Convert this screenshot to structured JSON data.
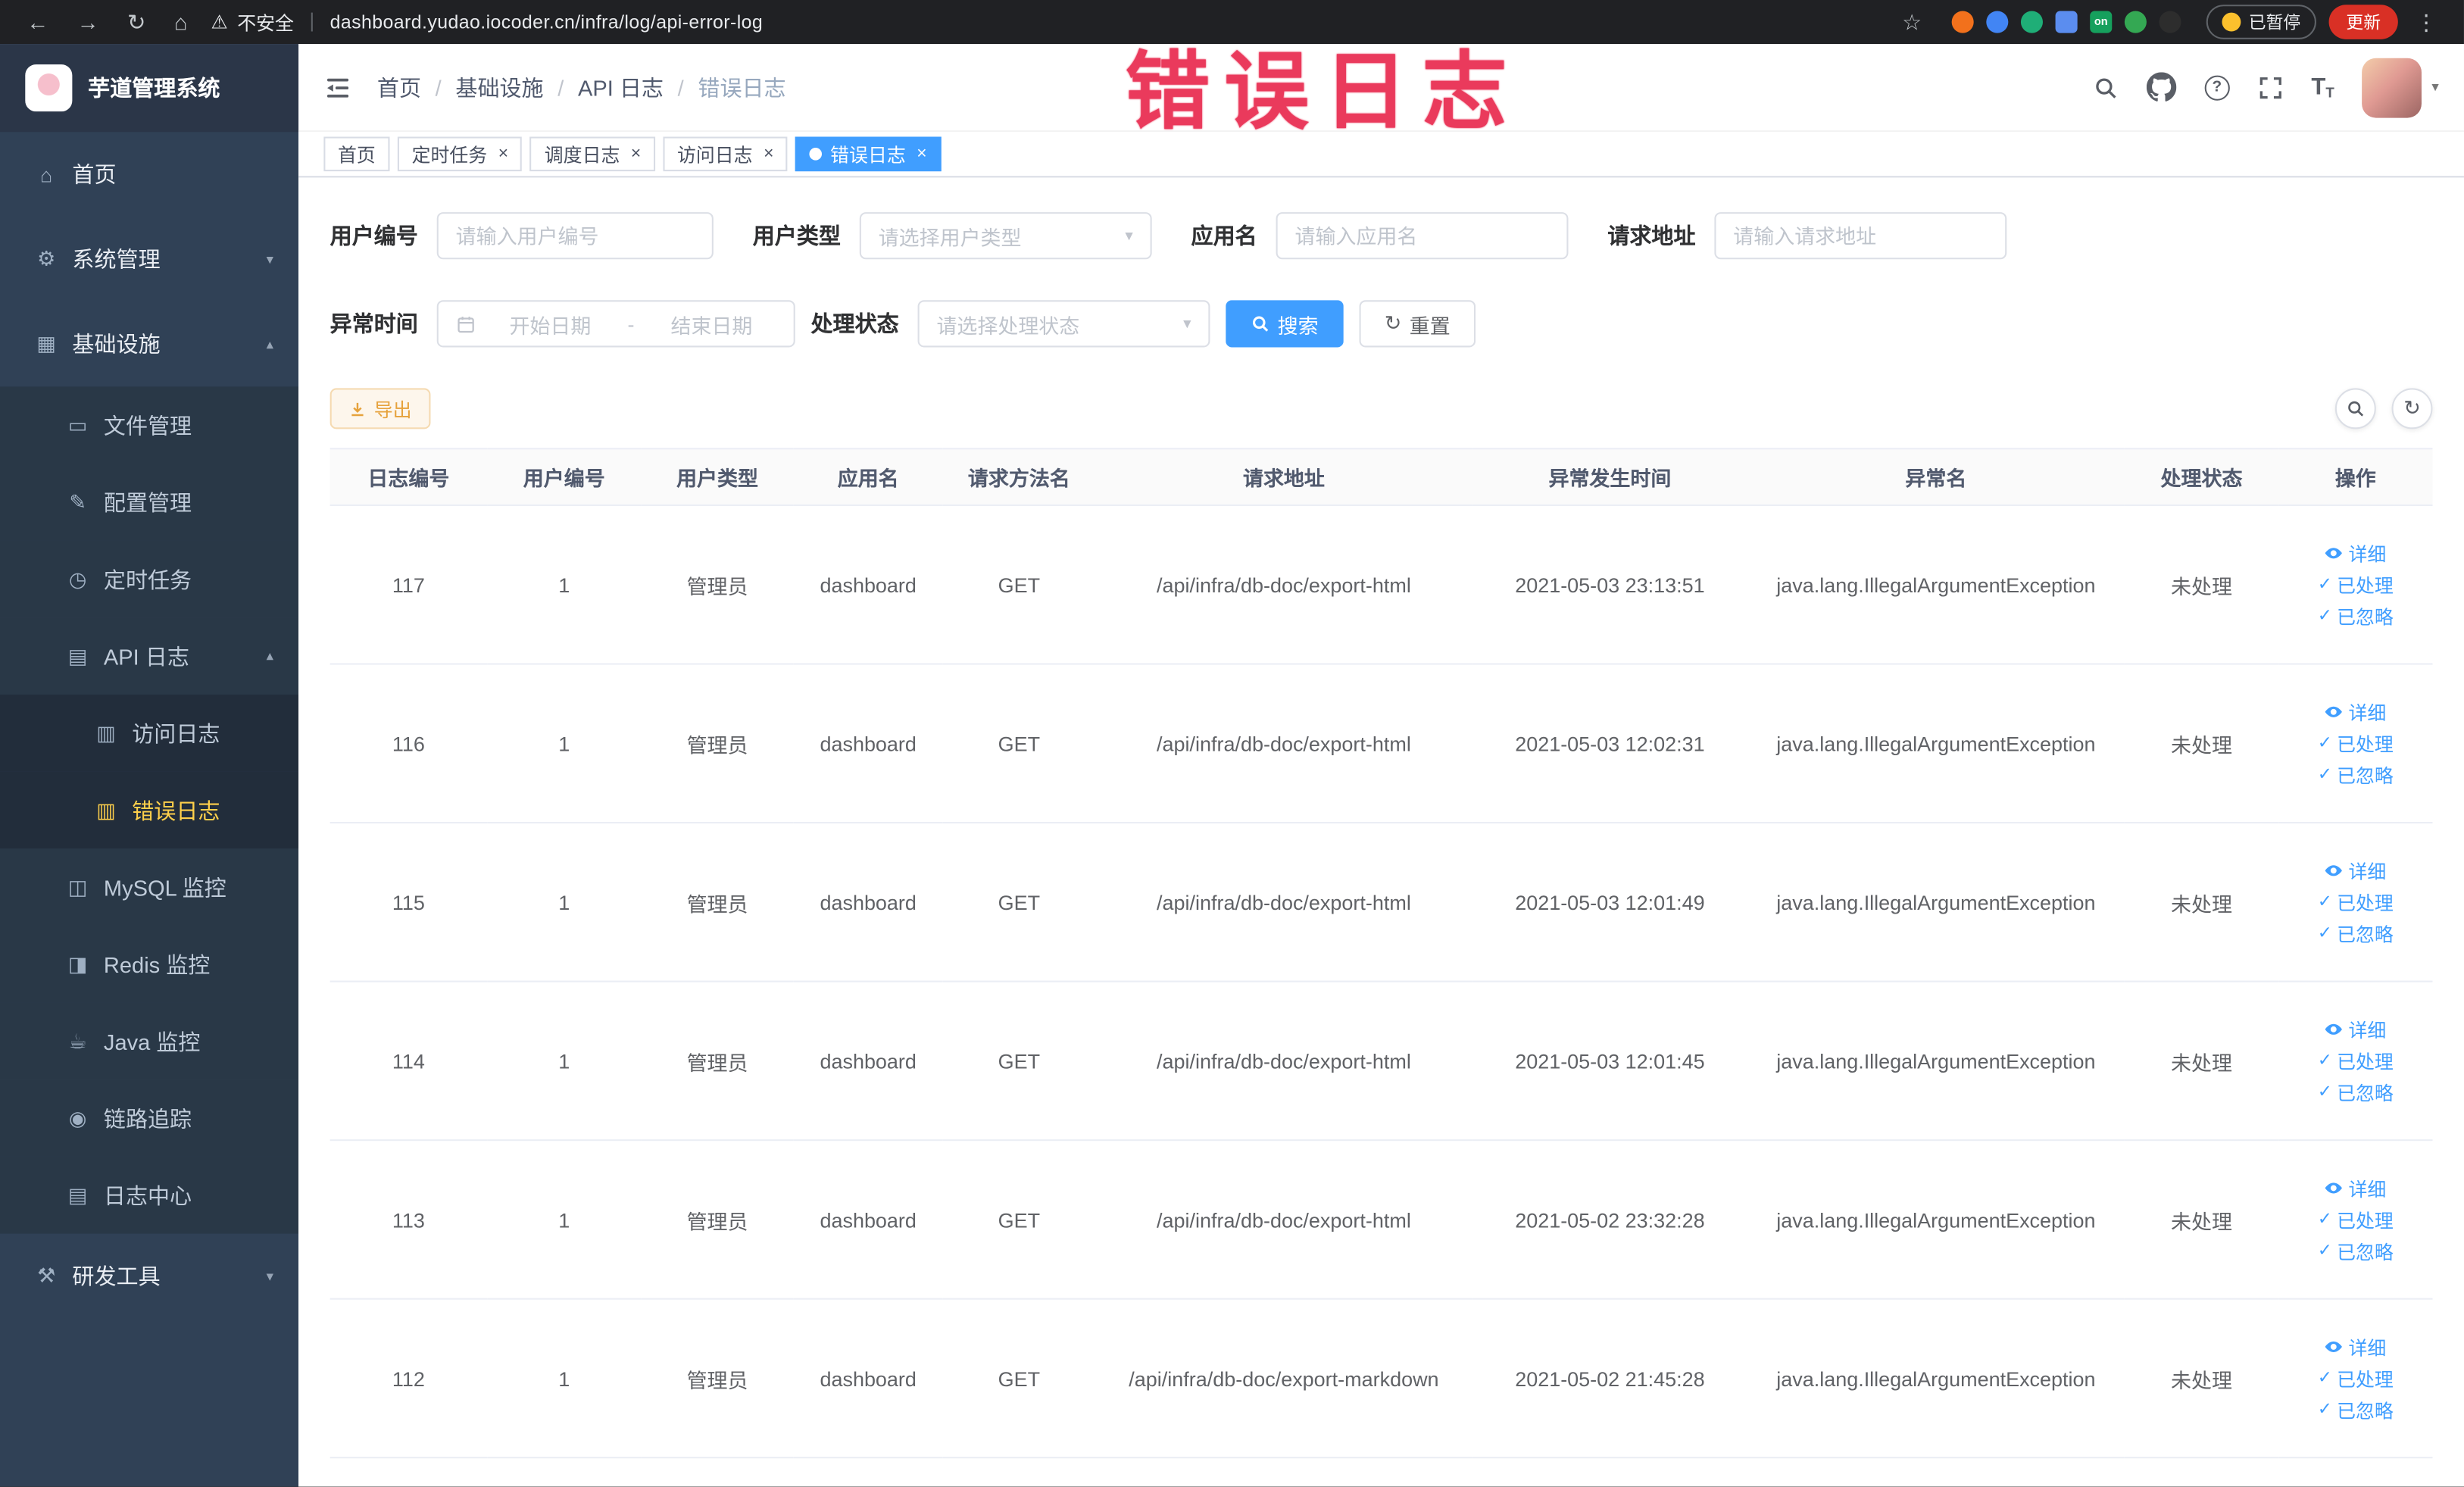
{
  "browser": {
    "security_label": "不安全",
    "url": "dashboard.yudao.iocoder.cn/infra/log/api-error-log",
    "paused_badge": "已暂停",
    "update_button": "更新",
    "extensions": [
      {
        "name": "extension-orange-icon",
        "color": "#f2711c",
        "shape": "circle"
      },
      {
        "name": "extension-blue-drop-icon",
        "color": "#4285f4",
        "shape": "circle"
      },
      {
        "name": "extension-teal-sync-icon",
        "color": "#1fae77",
        "shape": "circle"
      },
      {
        "name": "extension-blue-grid-icon",
        "color": "#5b8def",
        "shape": "square"
      },
      {
        "name": "extension-green-on-icon",
        "color": "#16a05d",
        "shape": "square",
        "label": "on"
      },
      {
        "name": "extension-green-leaf-icon",
        "color": "#34a853",
        "shape": "circle"
      },
      {
        "name": "extension-dark-paw-icon",
        "color": "#2d2d2d",
        "shape": "circle"
      }
    ]
  },
  "annotation": {
    "text": "错误日志"
  },
  "colors": {
    "accent": "#409eff",
    "sidebar_bg": "#304156",
    "active_menu_text": "#ffd04b",
    "warning": "#e6a23c",
    "annotation": "#ea3a5c"
  },
  "sidebar": {
    "logo_title": "芋道管理系统",
    "items": [
      {
        "id": "home",
        "label": "首页",
        "icon": "home-icon",
        "level": 0
      },
      {
        "id": "system",
        "label": "系统管理",
        "icon": "gear-icon",
        "level": 0,
        "arrow": "down"
      },
      {
        "id": "infrastructure",
        "label": "基础设施",
        "icon": "infra-icon",
        "level": 0,
        "arrow": "up"
      },
      {
        "id": "file",
        "label": "文件管理",
        "icon": "folder-icon",
        "level": 1
      },
      {
        "id": "config",
        "label": "配置管理",
        "icon": "config-icon",
        "level": 1
      },
      {
        "id": "job",
        "label": "定时任务",
        "icon": "timer-icon",
        "level": 1
      },
      {
        "id": "api-log",
        "label": "API 日志",
        "icon": "api-log-icon",
        "level": 1,
        "arrow": "up"
      },
      {
        "id": "access-log",
        "label": "访问日志",
        "icon": "access-log-icon",
        "level": 2
      },
      {
        "id": "error-log",
        "label": "错误日志",
        "icon": "error-log-icon",
        "level": 2,
        "active": true
      },
      {
        "id": "mysql",
        "label": "MySQL 监控",
        "icon": "mysql-icon",
        "level": 1
      },
      {
        "id": "redis",
        "label": "Redis 监控",
        "icon": "redis-icon",
        "level": 1
      },
      {
        "id": "java",
        "label": "Java 监控",
        "icon": "java-icon",
        "level": 1
      },
      {
        "id": "trace",
        "label": "链路追踪",
        "icon": "tracing-icon",
        "level": 1
      },
      {
        "id": "log-center",
        "label": "日志中心",
        "icon": "log-center-icon",
        "level": 1
      },
      {
        "id": "devtools",
        "label": "研发工具",
        "icon": "devtools-icon",
        "level": 0,
        "arrow": "down"
      }
    ]
  },
  "breadcrumb": {
    "separator": "/",
    "items": [
      "首页",
      "基础设施",
      "API 日志",
      "错误日志"
    ]
  },
  "tabs": [
    {
      "label": "首页",
      "closable": false,
      "active": false
    },
    {
      "label": "定时任务",
      "closable": true,
      "active": false
    },
    {
      "label": "调度日志",
      "closable": true,
      "active": false
    },
    {
      "label": "访问日志",
      "closable": true,
      "active": false
    },
    {
      "label": "错误日志",
      "closable": true,
      "active": true
    }
  ],
  "filters": {
    "user_id": {
      "label": "用户编号",
      "placeholder": "请输入用户编号"
    },
    "user_type": {
      "label": "用户类型",
      "placeholder": "请选择用户类型"
    },
    "app_name": {
      "label": "应用名",
      "placeholder": "请输入应用名"
    },
    "request_url": {
      "label": "请求地址",
      "placeholder": "请输入请求地址"
    },
    "exception_time": {
      "label": "异常时间",
      "start_placeholder": "开始日期",
      "separator": "-",
      "end_placeholder": "结束日期"
    },
    "process_status": {
      "label": "处理状态",
      "placeholder": "请选择处理状态"
    },
    "search_button": "搜索",
    "reset_button": "重置"
  },
  "toolbar": {
    "export_button": "导出"
  },
  "table": {
    "columns": [
      "日志编号",
      "用户编号",
      "用户类型",
      "应用名",
      "请求方法名",
      "请求地址",
      "异常发生时间",
      "异常名",
      "处理状态",
      "操作"
    ],
    "rows": [
      {
        "id": "117",
        "user_id": "1",
        "user_type": "管理员",
        "app": "dashboard",
        "method": "GET",
        "url": "/api/infra/db-doc/export-html",
        "time": "2021-05-03 23:13:51",
        "exception": "java.lang.IllegalArgumentException",
        "status": "未处理"
      },
      {
        "id": "116",
        "user_id": "1",
        "user_type": "管理员",
        "app": "dashboard",
        "method": "GET",
        "url": "/api/infra/db-doc/export-html",
        "time": "2021-05-03 12:02:31",
        "exception": "java.lang.IllegalArgumentException",
        "status": "未处理"
      },
      {
        "id": "115",
        "user_id": "1",
        "user_type": "管理员",
        "app": "dashboard",
        "method": "GET",
        "url": "/api/infra/db-doc/export-html",
        "time": "2021-05-03 12:01:49",
        "exception": "java.lang.IllegalArgumentException",
        "status": "未处理"
      },
      {
        "id": "114",
        "user_id": "1",
        "user_type": "管理员",
        "app": "dashboard",
        "method": "GET",
        "url": "/api/infra/db-doc/export-html",
        "time": "2021-05-03 12:01:45",
        "exception": "java.lang.IllegalArgumentException",
        "status": "未处理"
      },
      {
        "id": "113",
        "user_id": "1",
        "user_type": "管理员",
        "app": "dashboard",
        "method": "GET",
        "url": "/api/infra/db-doc/export-html",
        "time": "2021-05-02 23:32:28",
        "exception": "java.lang.IllegalArgumentException",
        "status": "未处理"
      },
      {
        "id": "112",
        "user_id": "1",
        "user_type": "管理员",
        "app": "dashboard",
        "method": "GET",
        "url": "/api/infra/db-doc/export-markdown",
        "time": "2021-05-02 21:45:28",
        "exception": "java.lang.IllegalArgumentException",
        "status": "未处理"
      }
    ],
    "actions": [
      {
        "name": "detail",
        "label": "详细",
        "icon": "eye-icon"
      },
      {
        "name": "processed",
        "label": "已处理",
        "icon": "check-icon"
      },
      {
        "name": "ignored",
        "label": "已忽略",
        "icon": "check-icon"
      }
    ]
  },
  "icon_glyphs": {
    "back": "←",
    "forward": "→",
    "reload": "↻",
    "browser-home": "⌂",
    "warning": "⚠",
    "star": "☆",
    "kebab": "⋮",
    "home": "⌂",
    "gear": "⚙",
    "infra": "▦",
    "folder": "▭",
    "config": "✎",
    "timer": "◷",
    "api-log": "▤",
    "access-log": "▥",
    "error-log": "▥",
    "mysql": "◫",
    "redis": "◨",
    "java": "☕",
    "tracing": "◉",
    "log-center": "▤",
    "devtools": "⚒",
    "arrow-down": "▾",
    "arrow-up": "▴",
    "chevron-down": "▾",
    "caret-down": "▾",
    "close": "×",
    "check": "✓",
    "refresh": "↻",
    "help": "?",
    "fontsize": "T"
  }
}
